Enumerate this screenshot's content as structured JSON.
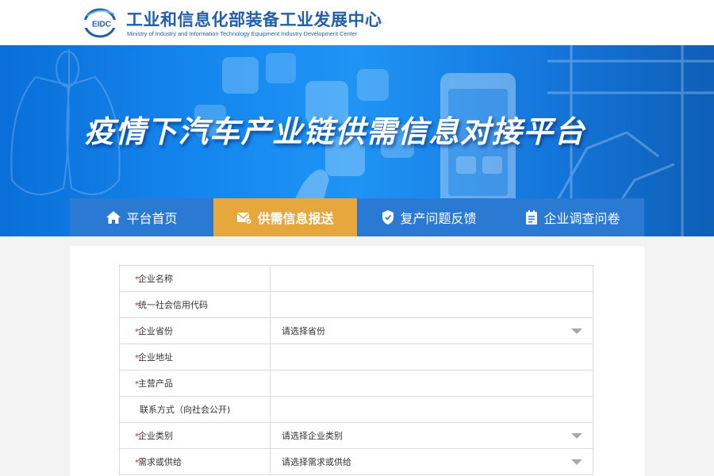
{
  "header": {
    "logo_text": "EIDC",
    "org_name_cn": "工业和信息化部装备工业发展中心",
    "org_name_en": "Ministry of Industry and Information Technology Equipment Industry Development Center"
  },
  "banner": {
    "title": "疫情下汽车产业链供需信息对接平台"
  },
  "nav": {
    "items": [
      {
        "label": "平台首页",
        "icon": "home-icon",
        "active": false
      },
      {
        "label": "供需信息报送",
        "icon": "mail-report-icon",
        "active": true
      },
      {
        "label": "复产问题反馈",
        "icon": "shield-feedback-icon",
        "active": false
      },
      {
        "label": "企业调查问卷",
        "icon": "survey-icon",
        "active": false
      }
    ]
  },
  "form": {
    "rows": [
      {
        "label": "企业名称",
        "required": true,
        "type": "text",
        "value": ""
      },
      {
        "label": "统一社会信用代码",
        "required": true,
        "type": "text",
        "value": ""
      },
      {
        "label": "企业省份",
        "required": true,
        "type": "select",
        "value": "请选择省份"
      },
      {
        "label": "企业地址",
        "required": true,
        "type": "text",
        "value": ""
      },
      {
        "label": "主营产品",
        "required": true,
        "type": "text",
        "value": ""
      },
      {
        "label": "联系方式（向社会公开)",
        "required": false,
        "type": "text",
        "value": ""
      },
      {
        "label": "企业类别",
        "required": true,
        "type": "select",
        "value": "请选择企业类别"
      },
      {
        "label": "需求或供给",
        "required": true,
        "type": "select",
        "value": "请选择需求或供给"
      }
    ],
    "required_mark": "*"
  },
  "colors": {
    "brand_blue": "#1f5fae",
    "nav_blue": "#2a79d3",
    "nav_active": "#e6a83c",
    "required": "#e02020"
  }
}
